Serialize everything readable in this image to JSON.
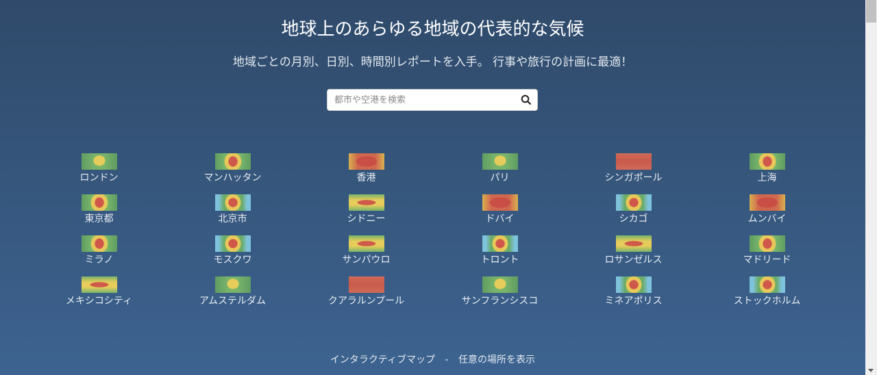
{
  "header": {
    "title": "地球上のあらゆる地域の代表的な気候",
    "subtitle": "地域ごとの月別、日別、時間別レポートを入手。 行事や旅行の計画に最適！"
  },
  "search": {
    "placeholder": "都市や空港を検索",
    "icon": "search-icon"
  },
  "cities": [
    {
      "name": "ロンドン",
      "thumb": "mild"
    },
    {
      "name": "マンハッタン",
      "thumb": "warm"
    },
    {
      "name": "香港",
      "thumb": "hot"
    },
    {
      "name": "パリ",
      "thumb": "mild"
    },
    {
      "name": "シンガポール",
      "thumb": "tropic"
    },
    {
      "name": "上海",
      "thumb": "warm"
    },
    {
      "name": "東京都",
      "thumb": "warm"
    },
    {
      "name": "北京市",
      "thumb": "cold"
    },
    {
      "name": "シドニー",
      "thumb": "band"
    },
    {
      "name": "ドバイ",
      "thumb": "hot"
    },
    {
      "name": "シカゴ",
      "thumb": "cold"
    },
    {
      "name": "ムンバイ",
      "thumb": "hot"
    },
    {
      "name": "ミラノ",
      "thumb": "warm"
    },
    {
      "name": "モスクワ",
      "thumb": "cold"
    },
    {
      "name": "サンパウロ",
      "thumb": "band"
    },
    {
      "name": "トロント",
      "thumb": "cold"
    },
    {
      "name": "ロサンゼルス",
      "thumb": "band"
    },
    {
      "name": "マドリード",
      "thumb": "warm"
    },
    {
      "name": "メキシコシティ",
      "thumb": "band"
    },
    {
      "name": "アムステルダム",
      "thumb": "mild"
    },
    {
      "name": "クアラルンプール",
      "thumb": "tropic"
    },
    {
      "name": "サンフランシスコ",
      "thumb": "mild"
    },
    {
      "name": "ミネアポリス",
      "thumb": "cold"
    },
    {
      "name": "ストックホルム",
      "thumb": "cold"
    }
  ],
  "footer": {
    "map_link": "インタラクティブマップ",
    "separator": "-",
    "any_place_link": "任意の場所を表示"
  }
}
